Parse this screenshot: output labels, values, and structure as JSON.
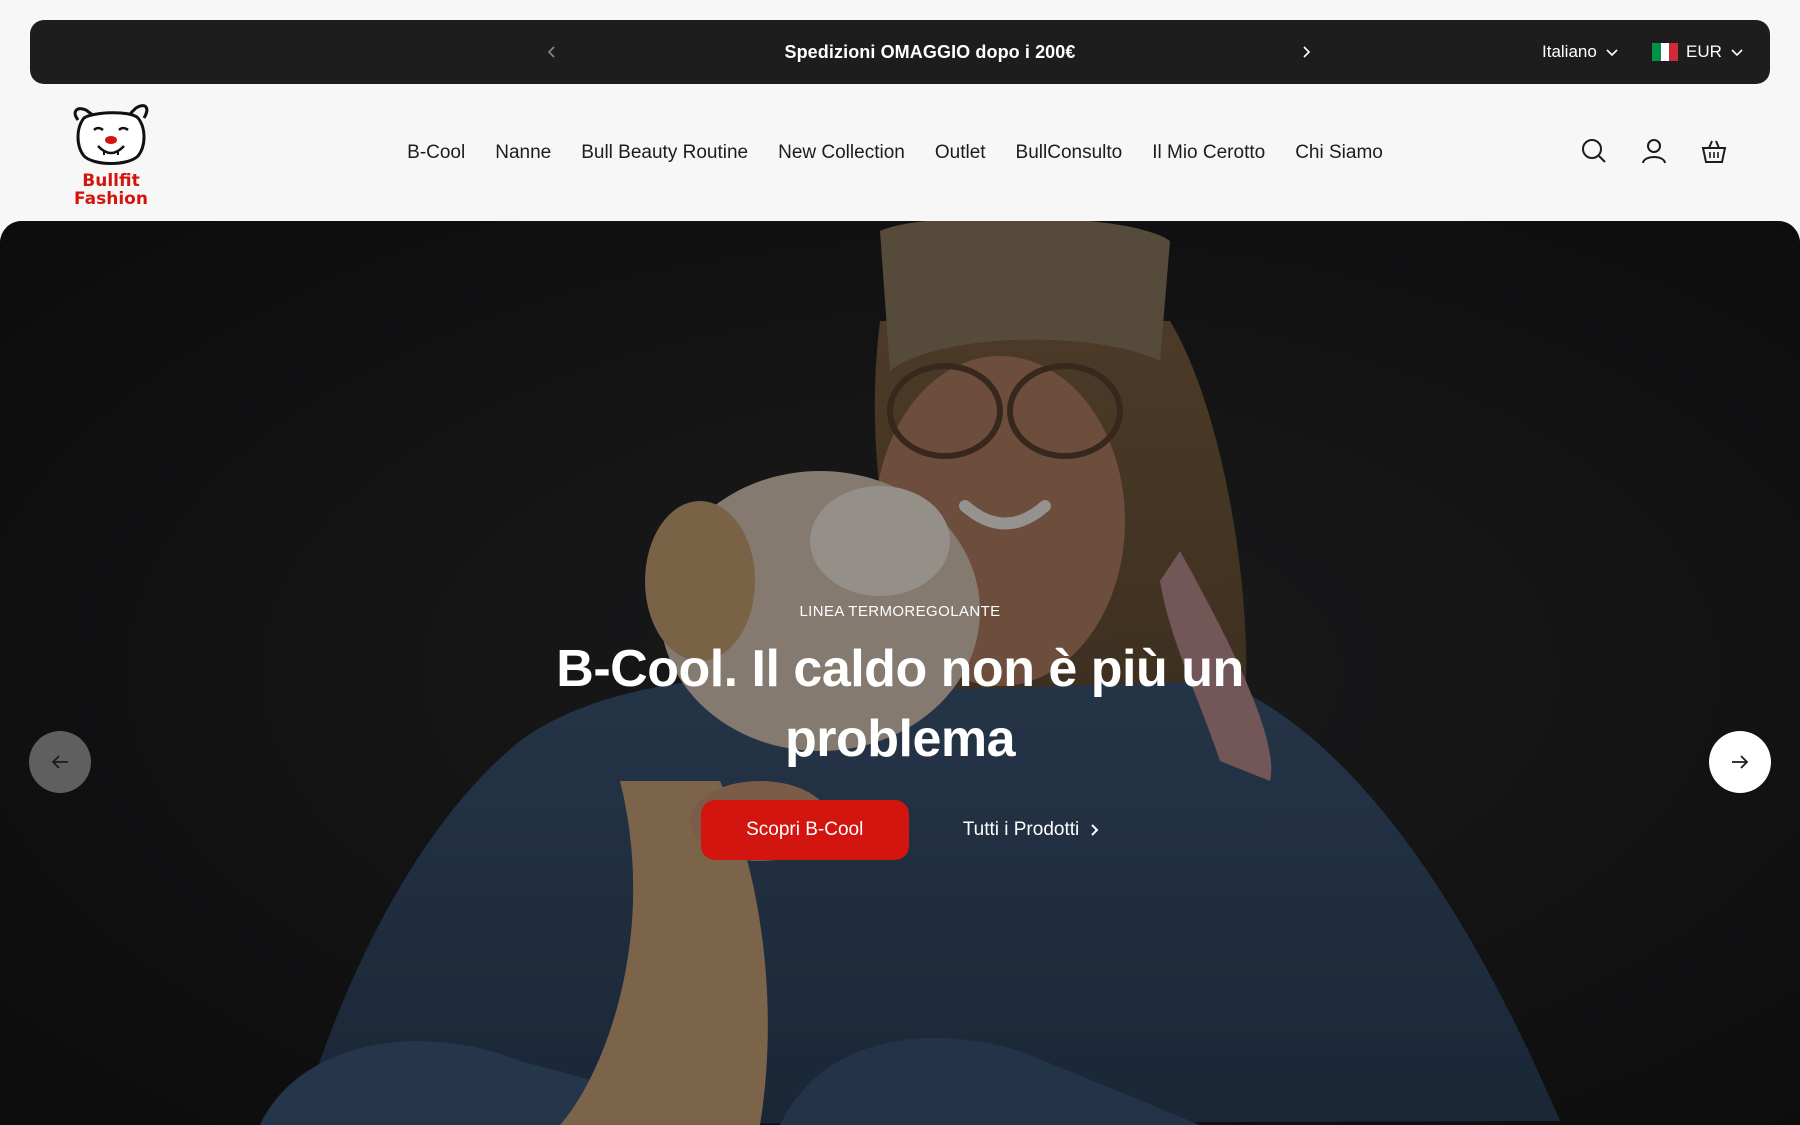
{
  "announcement": {
    "message": "Spedizioni OMAGGIO dopo i 200€",
    "language": "Italiano",
    "currency": "EUR",
    "flag_colors": [
      "#009246",
      "#ffffff",
      "#ce2b37"
    ]
  },
  "logo": {
    "line1": "Bullfit",
    "line2": "Fashion",
    "color": "#d2160f"
  },
  "nav": {
    "items": [
      {
        "label": "B-Cool"
      },
      {
        "label": "Nanne"
      },
      {
        "label": "Bull Beauty Routine"
      },
      {
        "label": "New Collection"
      },
      {
        "label": "Outlet"
      },
      {
        "label": "BullConsulto"
      },
      {
        "label": "Il Mio Cerotto"
      },
      {
        "label": "Chi Siamo"
      }
    ]
  },
  "header_icons": [
    "search-icon",
    "account-icon",
    "cart-basket-icon"
  ],
  "hero": {
    "eyebrow": "LINEA TERMOREGOLANTE",
    "headline": "B-Cool. Il caldo non è più un problema",
    "primary_cta": "Scopri B-Cool",
    "secondary_cta": "Tutti i Prodotti",
    "accent_color": "#d2160f"
  }
}
